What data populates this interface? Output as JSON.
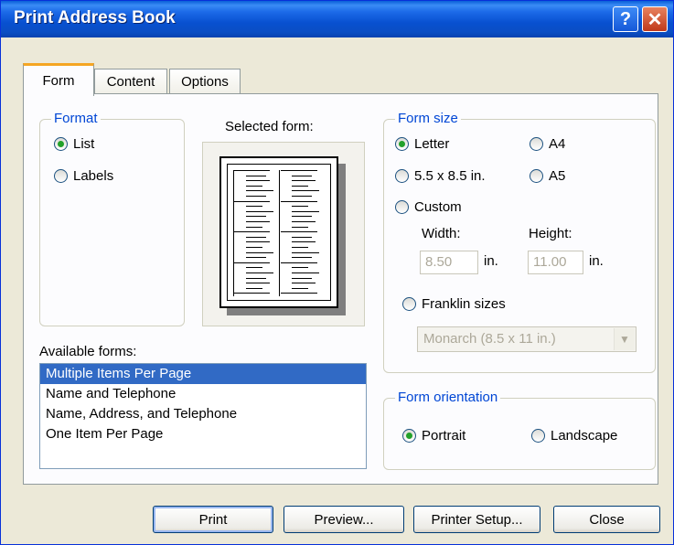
{
  "window": {
    "title": "Print Address Book"
  },
  "tabs": [
    "Form",
    "Content",
    "Options"
  ],
  "format": {
    "label": "Format",
    "options": [
      {
        "label": "List",
        "checked": true
      },
      {
        "label": "Labels",
        "checked": false
      }
    ]
  },
  "selected_form_label": "Selected form:",
  "form_size": {
    "label": "Form size",
    "options": [
      {
        "label": "Letter",
        "checked": true
      },
      {
        "label": "A4",
        "checked": false
      },
      {
        "label": "5.5 x 8.5 in.",
        "checked": false
      },
      {
        "label": "A5",
        "checked": false
      },
      {
        "label": "Custom",
        "checked": false
      }
    ],
    "width_label": "Width:",
    "height_label": "Height:",
    "width_value": "8.50",
    "height_value": "11.00",
    "unit": "in.",
    "franklin_label": "Franklin sizes",
    "franklin_value": "Monarch  (8.5 x 11 in.)"
  },
  "available_forms": {
    "label": "Available forms:",
    "items": [
      "Multiple Items Per Page",
      "Name and Telephone",
      "Name, Address, and Telephone",
      "One Item Per Page"
    ],
    "selected_index": 0
  },
  "orientation": {
    "label": "Form orientation",
    "options": [
      {
        "label": "Portrait",
        "checked": true
      },
      {
        "label": "Landscape",
        "checked": false
      }
    ]
  },
  "buttons": {
    "print": "Print",
    "preview": "Preview...",
    "printer_setup": "Printer Setup...",
    "close": "Close"
  },
  "icons": {
    "help": "question-mark",
    "close": "x-mark"
  }
}
